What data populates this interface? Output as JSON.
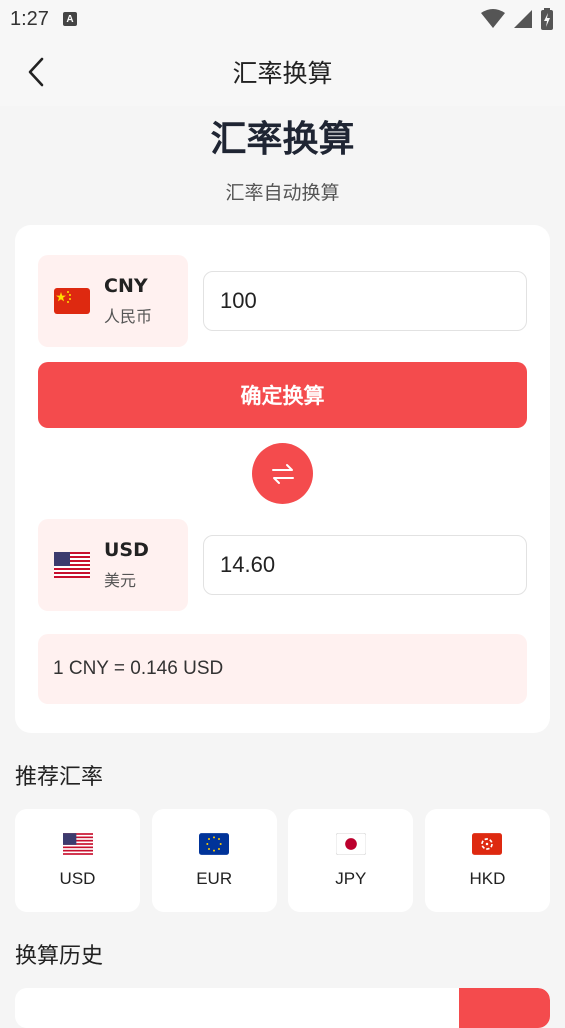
{
  "status_bar": {
    "time": "1:27",
    "badge": "A"
  },
  "app_bar": {
    "title": "汇率换算"
  },
  "page": {
    "title": "汇率换算",
    "subtitle": "汇率自动换算"
  },
  "converter": {
    "from": {
      "code": "CNY",
      "name": "人民币",
      "flag": "cn-flag-icon",
      "amount": "100"
    },
    "confirm_label": "确定换算",
    "to": {
      "code": "USD",
      "name": "美元",
      "flag": "us-flag-icon",
      "amount": "14.60"
    },
    "rate_text": "1 CNY = 0.146 USD"
  },
  "recommended": {
    "title": "推荐汇率",
    "items": [
      {
        "code": "USD",
        "flag": "us-flag-icon"
      },
      {
        "code": "EUR",
        "flag": "eu-flag-icon"
      },
      {
        "code": "JPY",
        "flag": "jp-flag-icon"
      },
      {
        "code": "HKD",
        "flag": "hk-flag-icon"
      }
    ]
  },
  "history": {
    "title": "换算历史"
  },
  "colors": {
    "accent": "#f44b4d",
    "tint": "#fff1f0",
    "background": "#f5f5f5"
  }
}
